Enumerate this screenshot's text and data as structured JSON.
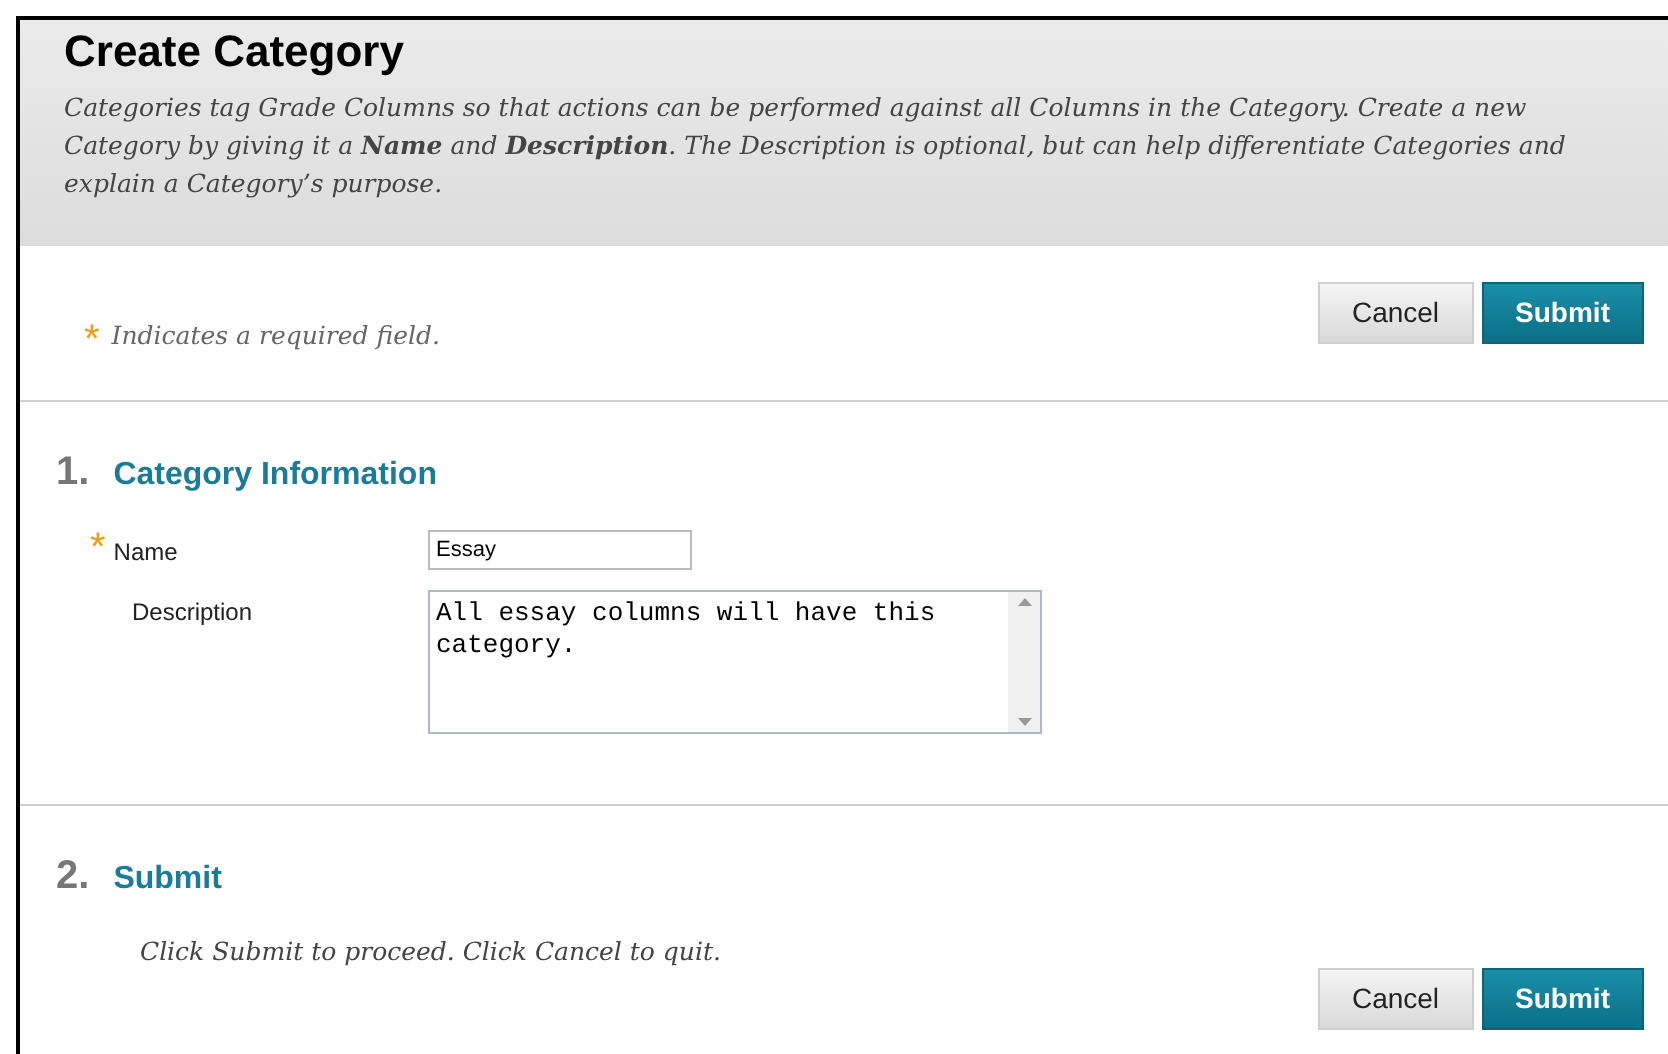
{
  "header": {
    "title": "Create Category",
    "description": "Categories tag Grade Columns so that actions can be performed against all Columns in the Category. Create a new Category by giving it a **Name** and **Description**. The Description is optional, but can help differentiate Categories and explain a Category’s purpose."
  },
  "required_note": {
    "marker": "*",
    "text": "Indicates a required field."
  },
  "top_buttons": [
    {
      "label": "Cancel",
      "kind": "secondary"
    },
    {
      "label": "Submit",
      "kind": "primary"
    }
  ],
  "sections": [
    {
      "number": "1.",
      "title": "Category Information",
      "fields": [
        {
          "kind": "text",
          "label": "Name",
          "required": true,
          "value": "Essay"
        },
        {
          "kind": "textarea",
          "label": "Description",
          "required": false,
          "value": "All essay columns will have this category."
        }
      ]
    },
    {
      "number": "2.",
      "title": "Submit",
      "instruction": "Click Submit to proceed. Click Cancel to quit.",
      "buttons": [
        {
          "label": "Cancel",
          "kind": "secondary"
        },
        {
          "label": "Submit",
          "kind": "primary"
        }
      ]
    }
  ]
}
